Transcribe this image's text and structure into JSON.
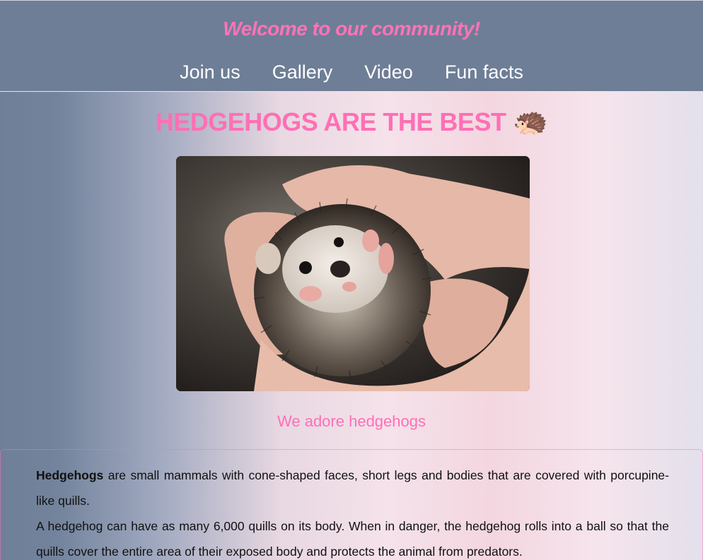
{
  "header": {
    "welcome": "Welcome to our community!",
    "nav": [
      "Join us",
      "Gallery",
      "Video",
      "Fun facts"
    ]
  },
  "main": {
    "title": "HEDGEHOGS ARE THE BEST",
    "title_emoji": "🦔",
    "image_alt": "Hedgehog held in two hands",
    "caption": "We adore hedgehogs"
  },
  "article": {
    "p1_bold": "Hedgehogs",
    "p1_rest": " are small mammals with cone-shaped faces, short legs and bodies that are covered with porcupine-like quills.",
    "p2": "A hedgehog can have as many 6,000 quills on its body. When in danger, the hedgehog rolls into a ball so that the quills cover the entire area of their exposed body and protects the animal from predators."
  },
  "colors": {
    "accent": "#ff6fb5",
    "header_bg": "#6e7e96"
  }
}
